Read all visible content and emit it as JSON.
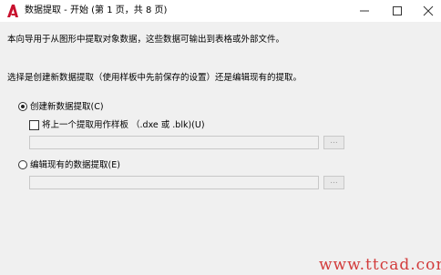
{
  "window": {
    "title": "数据提取 - 开始 (第 1 页，共 8 页)",
    "controls": {
      "minimize_icon": "minimize-icon",
      "maximize_icon": "maximize-icon",
      "close_icon": "close-icon"
    }
  },
  "intro_text": "本向导用于从图形中提取对象数据，这些数据可输出到表格或外部文件。",
  "prompt_text": "选择是创建新数据提取（使用样板中先前保存的设置）还是编辑现有的提取。",
  "options": {
    "create_new": {
      "label": "创建新数据提取(C)",
      "selected": true
    },
    "use_template": {
      "label": "将上一个提取用作样板 （.dxe 或 .blk)(U)",
      "checked": false
    },
    "template_path": {
      "value": "",
      "browse_label": "..."
    },
    "edit_existing": {
      "label": "编辑现有的数据提取(E)",
      "selected": false
    },
    "existing_path": {
      "value": "",
      "browse_label": "..."
    }
  },
  "watermark": "www.ttcad.com",
  "colors": {
    "accent_icon": "#c8102e",
    "watermark": "#d23a3a"
  }
}
